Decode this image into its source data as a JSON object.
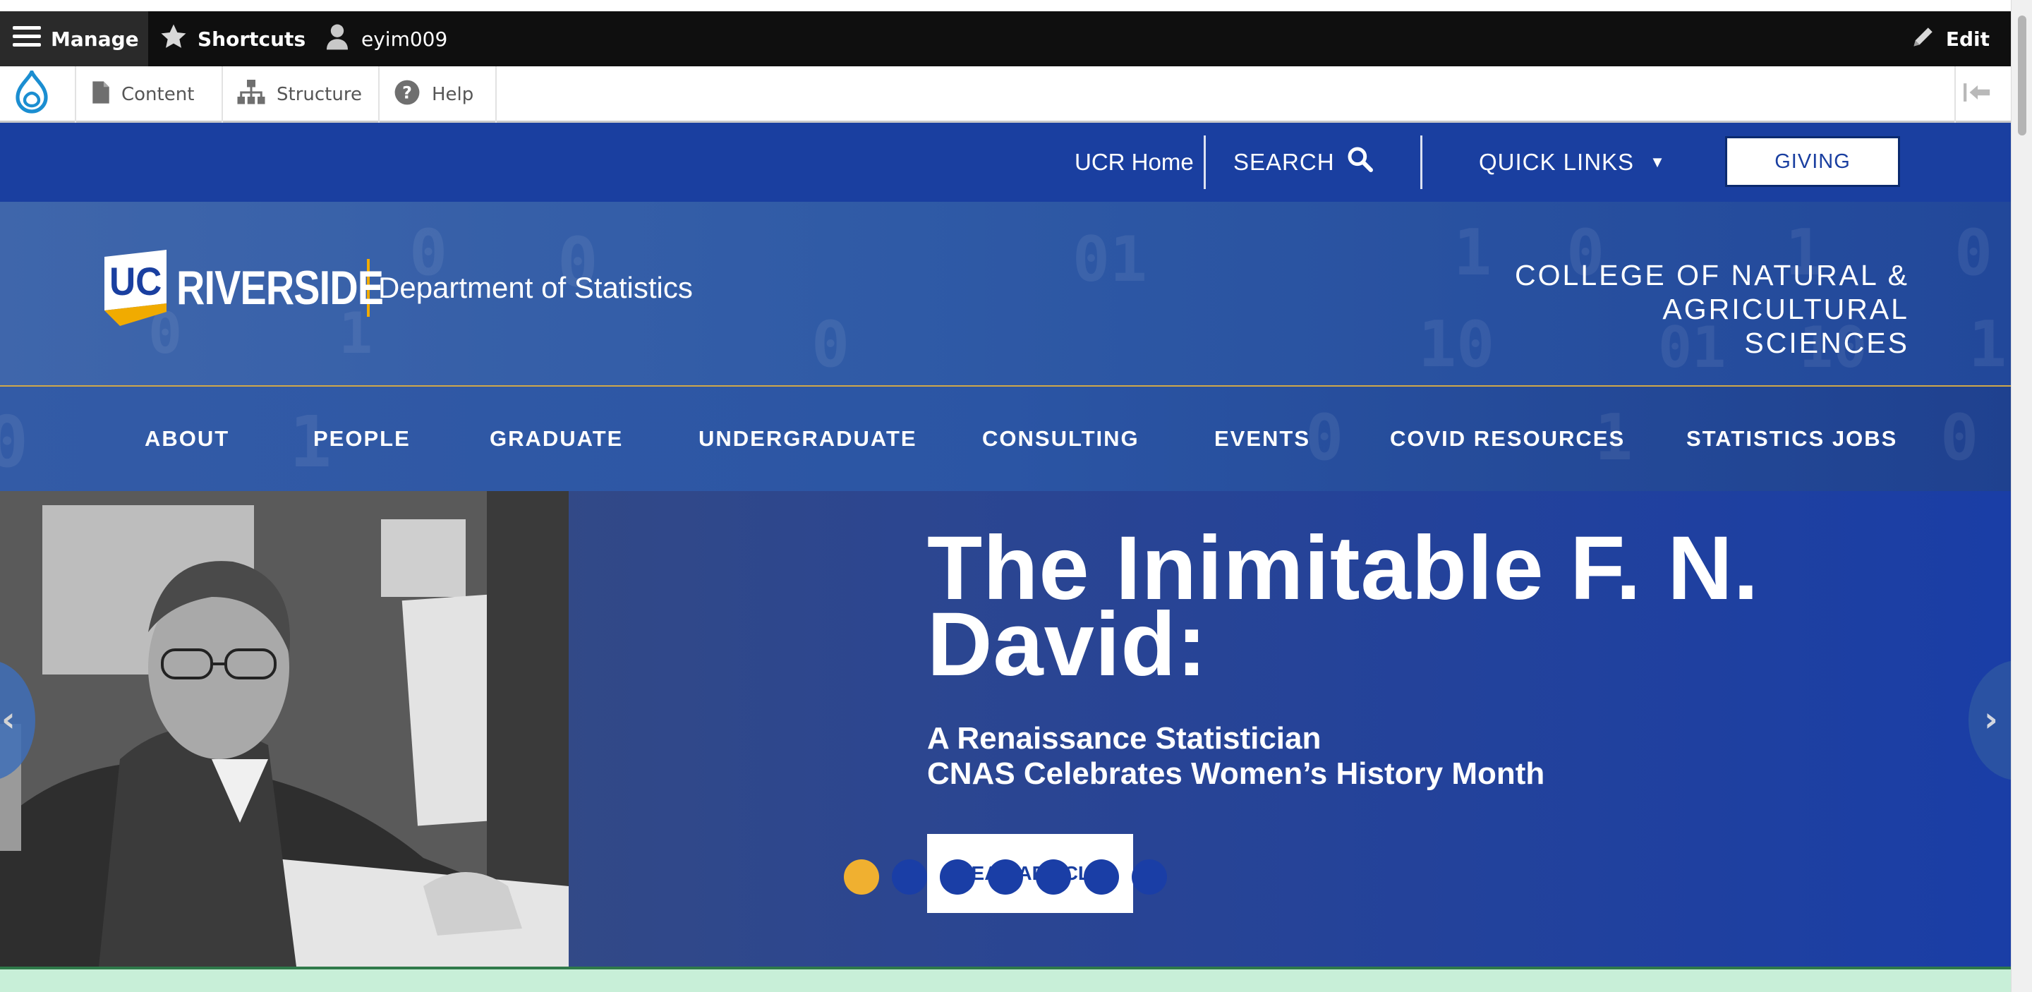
{
  "admin_toolbar": {
    "manage_label": "Manage",
    "shortcuts_label": "Shortcuts",
    "user_label": "eyim009",
    "edit_label": "Edit"
  },
  "admin_tray": {
    "content_label": "Content",
    "structure_label": "Structure",
    "help_label": "Help"
  },
  "utility": {
    "home_label": "UCR Home",
    "search_label": "SEARCH",
    "quick_links_label": "QUICK LINKS",
    "giving_label": "GIVING"
  },
  "header": {
    "logo_uc": "UC",
    "logo_riverside": "RIVERSIDE",
    "department": "Department of Statistics",
    "college_line1": "COLLEGE OF NATURAL & AGRICULTURAL",
    "college_line2": "SCIENCES"
  },
  "nav": {
    "items": [
      "ABOUT",
      "PEOPLE",
      "GRADUATE",
      "UNDERGRADUATE",
      "CONSULTING",
      "EVENTS",
      "COVID RESOURCES",
      "STATISTICS JOBS"
    ]
  },
  "hero": {
    "title_line1": "The Inimitable F. N.",
    "title_line2": "David:",
    "subtitle_line1": "A Renaissance Statistician",
    "subtitle_line2": "CNAS Celebrates Women’s History Month",
    "button_label": "READ ARTICLE",
    "slide_count": 7,
    "active_slide": 1
  },
  "colors": {
    "admin_bar": "#0f0f0f",
    "ucr_blue": "#1a3fa0",
    "ucr_gold": "#f1ab00",
    "active_dot": "#f0b030"
  },
  "icons": [
    "menu-icon",
    "star-icon",
    "user-icon",
    "pencil-icon",
    "drupal-drop-icon",
    "document-icon",
    "sitemap-icon",
    "help-icon",
    "collapse-icon",
    "search-icon",
    "caret-down-icon",
    "chevron-left-icon",
    "chevron-right-icon"
  ]
}
